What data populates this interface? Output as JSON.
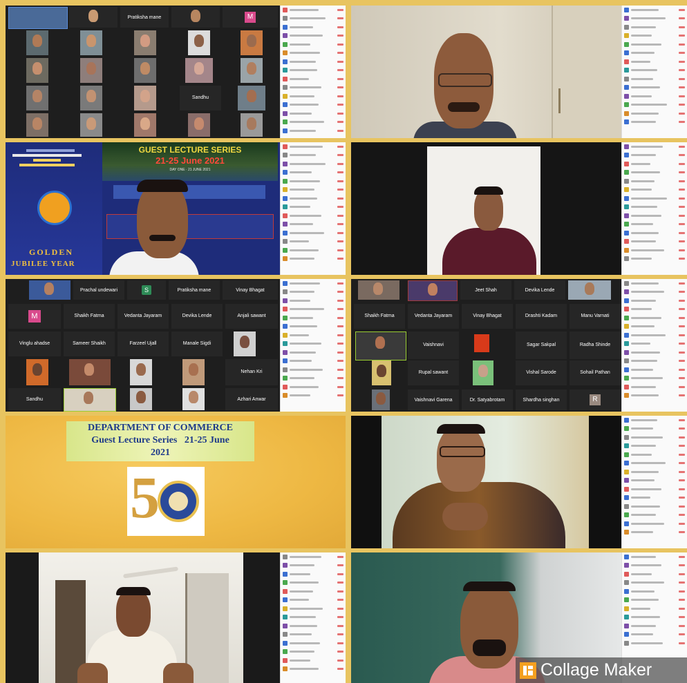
{
  "grid1": {
    "names": [
      "Pratiksha mane"
    ],
    "badge": "M",
    "label": "Sandhu"
  },
  "poster": {
    "series_title": "GUEST LECTURE SERIES",
    "dates": "21-25 June 2021",
    "day_line": "DAY ONE · 21 JUNE 2021",
    "golden": "GOLDEN",
    "jubilee": "JUBILEE YEAR"
  },
  "grid3": {
    "names": [
      "Prachal undewari",
      "Pratiksha mane",
      "Vinay Bhagat",
      "Shaikh Fatma",
      "Vedanta Jayaram",
      "Devika Lende",
      "Anjali sawant",
      "Vinglu ahadse",
      "Sameer Shaikh",
      "Farzeel Ujall",
      "Manale Sigdi",
      "Nehan Kri",
      "Sandhu",
      "Azhari Anwar"
    ],
    "badge_s": "S",
    "badge_m": "M"
  },
  "grid4": {
    "names": [
      "Jeet Shah",
      "Devika Lende",
      "Shaikh Fatma",
      "Vedanta Jayaram",
      "Vinay Bhagat",
      "Drashti Kadam",
      "Manu Varnati",
      "Vaishnavi",
      "Sagar Sakpal",
      "Radha Shinde",
      "Rupal sawant",
      "Vishal Sarode",
      "Sohail Pathan",
      "Vaishnavi Garena",
      "Dr. Satyabrotam",
      "Shardha singhan"
    ],
    "badge_r": "R"
  },
  "commerce": {
    "dept": "DEPARTMENT OF COMMERCE",
    "series": "Guest Lecture Series   21-25 June",
    "year": "2021",
    "logo_digit": "5"
  },
  "watermark": {
    "text": "Collage Maker"
  }
}
